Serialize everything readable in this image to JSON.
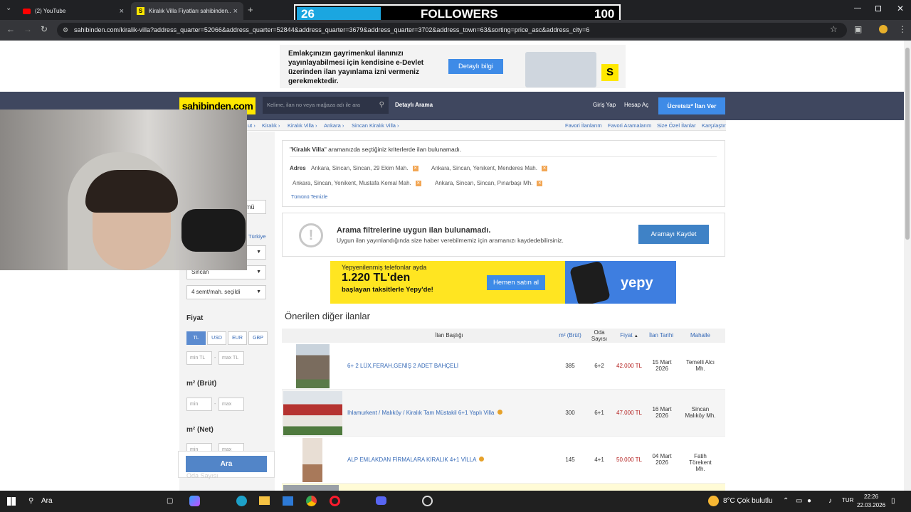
{
  "browser": {
    "tabs": [
      {
        "label": "(2) YouTube"
      },
      {
        "label": "Kiralık Villa Fiyatları sahibinden..."
      }
    ],
    "url": "sahibinden.com/kiralik-villa?address_quarter=52066&address_quarter=52844&address_quarter=3679&address_quarter=3702&address_town=63&sorting=price_asc&address_city=6"
  },
  "overlay": {
    "count_current": "26",
    "label": "FOLLOWERS",
    "count_goal": "100",
    "progress": 0.26
  },
  "top_ad": {
    "text": "Emlakçınızın gayrimenkul ilanınızı yayınlayabilmesi için kendisine e-Devlet üzerinden ilan yayınlama izni vermeniz gerekmektedir.",
    "button": "Detaylı bilgi",
    "badge": "S"
  },
  "header": {
    "logo": "sahibinden.com",
    "search_placeholder": "Kelime, ilan no veya mağaza adı ile ara",
    "detailed_search": "Detaylı Arama",
    "login": "Giriş Yap",
    "register": "Hesap Aç",
    "post_ad": "Ücretsiz* İlan Ver"
  },
  "breadcrumb": {
    "items": [
      "ut ›",
      "Kiralık ›",
      "Kiralık Villa ›",
      "Ankara ›",
      "Sincan Kiralık Villa ›"
    ],
    "right_links": [
      "Favori İlanlarım",
      "Favori Aramalarım",
      "Size Özel İlanlar",
      "Karşılaştır"
    ]
  },
  "sidebar": {
    "partial_button": "mü",
    "country_link": "Türkiye",
    "town_select": "Sincan",
    "quarter_select": "4 semt/mah. seçildi",
    "price_heading": "Fiyat",
    "currencies": [
      "TL",
      "USD",
      "EUR",
      "GBP"
    ],
    "min_tl": "min TL",
    "max_tl": "max TL",
    "area_gross_heading": "m² (Brüt)",
    "min": "min",
    "max": "max",
    "area_net_heading": "m² (Net)",
    "rooms_heading": "Oda Sayısı",
    "search_button": "Ara"
  },
  "filters": {
    "summary_prefix": "\"",
    "summary_keyword": "Kiralık Villa",
    "summary_rest": "\" aramanızda seçtiğiniz kriterlerde ilan bulunamadı.",
    "address_label": "Adres",
    "tags": [
      "Ankara, Sincan, Sincan, 29 Ekim Mah.",
      "Ankara, Sincan, Yenikent, Menderes Mah.",
      "Ankara, Sincan, Yenikent, Mustafa Kemal Mah.",
      "Ankara, Sincan, Sincan, Pınarbaşı Mh."
    ],
    "clear_all": "Tümünü Temizle"
  },
  "no_result": {
    "title": "Arama filtrelerine uygun ilan bulunamadı.",
    "subtitle": "Uygun ilan yayınlandığında size haber verebilmemiz için aramanızı kaydedebilirsiniz.",
    "save_button": "Aramayı Kaydet"
  },
  "yepy_ad": {
    "line1": "Yepyenilenmiş telefonlar ayda",
    "price": "1.220 TL'den",
    "line2": "başlayan taksitlerle Yepy'de!",
    "button": "Hemen satın al",
    "brand": "yepy"
  },
  "suggested": {
    "title": "Önerilen diğer ilanlar",
    "columns": [
      "İlan Başlığı",
      "m² (Brüt)",
      "Oda Sayısı",
      "Fiyat",
      "İlan Tarihi",
      "Mahalle"
    ],
    "sort_indicator": "▲",
    "rows": [
      {
        "title": "6+ 2 LÜX,FERAH,GENİŞ 2 ADET BAHÇELİ",
        "area": "385",
        "rooms": "6+2",
        "price": "42.000 TL",
        "date": "15 Mart 2026",
        "district": "Temelli Alcı Mh."
      },
      {
        "title": "Ihlamurkent / Malıköy / Kiralık Tam Müstakil 6+1 Yaplı Villa",
        "area": "300",
        "rooms": "6+1",
        "price": "47.000 TL",
        "date": "16 Mart 2026",
        "district": "Sincan Malıköy Mh."
      },
      {
        "title": "ALP EMLAKDAN FİRMALARA KİRALIK 4+1 VİLLA",
        "area": "145",
        "rooms": "4+1",
        "price": "50.000 TL",
        "date": "04 Mart 2026",
        "district": "Fatih Törekent Mh."
      }
    ]
  },
  "taskbar": {
    "search": "Ara",
    "weather": "8°C Çok bulutlu",
    "lang": "TUR",
    "time": "22:26",
    "date": "22.03.2026"
  },
  "colors": {
    "header_bg": "#3f475f",
    "logo_yellow": "#ffe800",
    "link_blue": "#366ab7",
    "price_red": "#b42120",
    "accent_blue": "#3e8be7"
  }
}
